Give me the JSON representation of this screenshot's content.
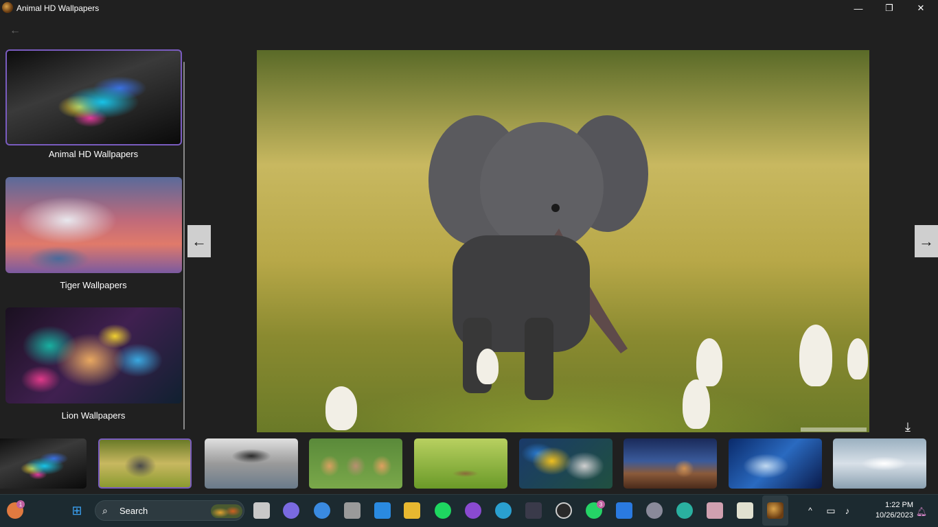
{
  "window": {
    "title": "Animal HD Wallpapers",
    "minimize_glyph": "—",
    "maximize_glyph": "❐",
    "close_glyph": "✕"
  },
  "nav": {
    "back_glyph": "←",
    "prev_glyph": "←",
    "next_glyph": "→",
    "download_glyph": "⤓"
  },
  "categories": [
    {
      "label": "Animal HD Wallpapers",
      "image": "butterfly",
      "selected": true
    },
    {
      "label": "Tiger Wallpapers",
      "image": "snow-leopard",
      "selected": false
    },
    {
      "label": "Lion Wallpapers",
      "image": "colorful-lion",
      "selected": false
    }
  ],
  "main_image": {
    "subject": "baby-elephant-with-egrets"
  },
  "thumbnails": [
    {
      "subject": "butterfly",
      "selected": false
    },
    {
      "subject": "elephant",
      "selected": true
    },
    {
      "subject": "eagle",
      "selected": false
    },
    {
      "subject": "kittens",
      "selected": false
    },
    {
      "subject": "green-field",
      "selected": false
    },
    {
      "subject": "parrot",
      "selected": false
    },
    {
      "subject": "cheetah",
      "selected": false
    },
    {
      "subject": "wolf",
      "selected": false
    },
    {
      "subject": "clouds-animal",
      "selected": false
    }
  ],
  "taskbar": {
    "search_placeholder": "Search",
    "weather_badge": "1",
    "whatsapp_badge": "3",
    "time": "1:22 PM",
    "date": "10/26/2023",
    "tray_chevron": "^"
  },
  "colors": {
    "background": "#202020",
    "accent": "#7a5cc0",
    "taskbar": "#1c2a30"
  }
}
